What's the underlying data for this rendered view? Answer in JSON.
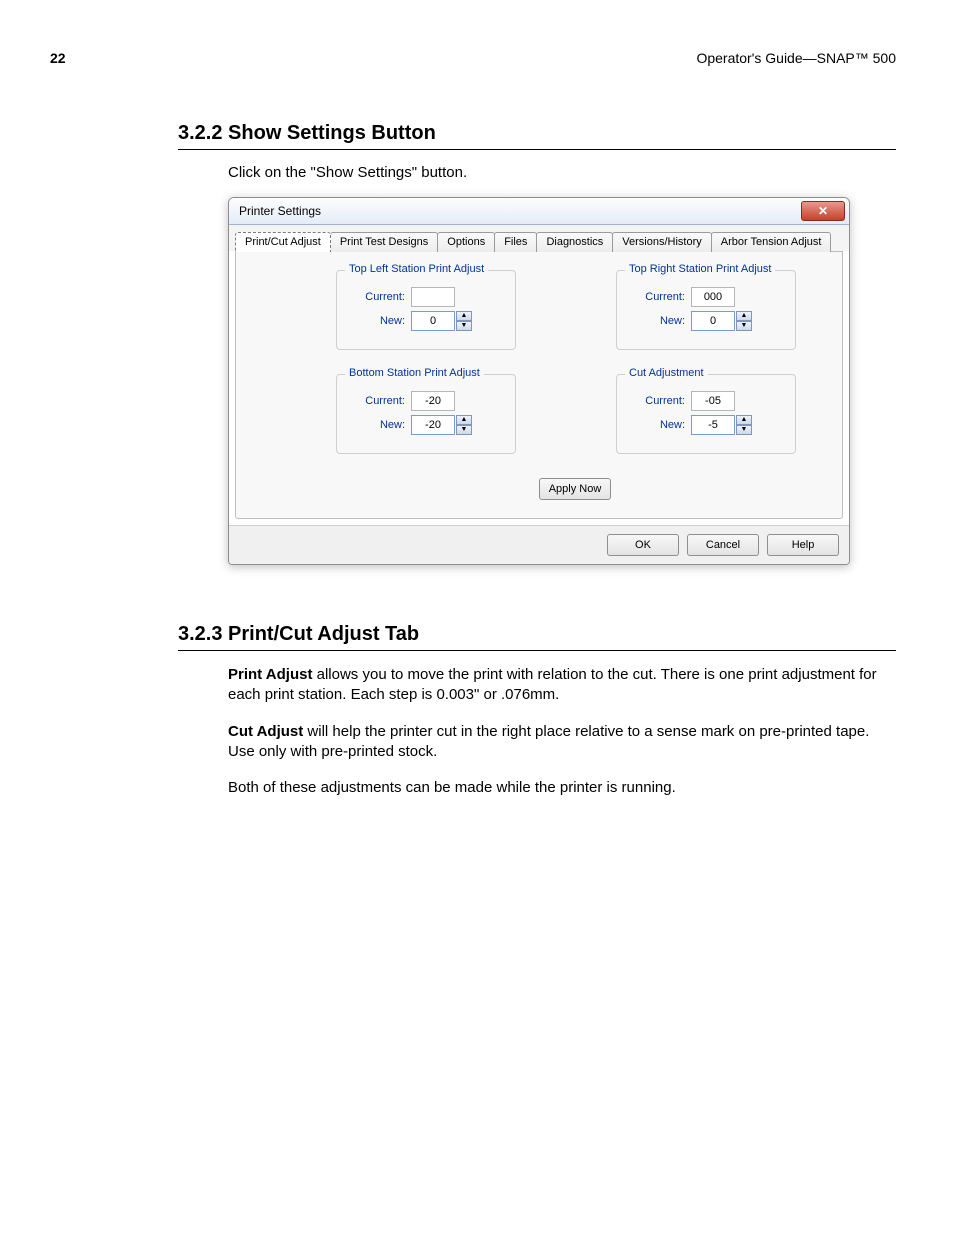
{
  "page": {
    "number": "22",
    "header_right": "Operator's Guide—SNAP™ 500"
  },
  "sections": {
    "s1": {
      "title": "3.2.2 Show Settings Button",
      "intro": "Click on the \"Show Settings\" button."
    },
    "s2": {
      "title": "3.2.3 Print/Cut Adjust Tab",
      "p1_strong": "Print Adjust",
      "p1_rest": " allows you to move the print with relation to the cut.  There is one print adjustment for each print station. Each step is 0.003\" or .076mm.",
      "p2_strong": "Cut Adjust",
      "p2_rest": " will help the printer cut in the right place relative to a sense mark on pre-printed tape. Use only with pre-printed stock.",
      "p3": "Both of these adjustments can be made while the printer is running."
    }
  },
  "dialog": {
    "title": "Printer Settings",
    "tabs": [
      "Print/Cut Adjust",
      "Print Test Designs",
      "Options",
      "Files",
      "Diagnostics",
      "Versions/History",
      "Arbor Tension Adjust"
    ],
    "groups": {
      "tl": {
        "legend": "Top Left Station Print Adjust",
        "current": "",
        "new": "0"
      },
      "tr": {
        "legend": "Top Right Station Print Adjust",
        "current": "000",
        "new": "0"
      },
      "bl": {
        "legend": "Bottom Station Print Adjust",
        "current": "-20",
        "new": "-20"
      },
      "cut": {
        "legend": "Cut Adjustment",
        "current": "-05",
        "new": "-5"
      }
    },
    "labels": {
      "current": "Current:",
      "new": "New:"
    },
    "buttons": {
      "apply": "Apply Now",
      "ok": "OK",
      "cancel": "Cancel",
      "help": "Help"
    }
  }
}
